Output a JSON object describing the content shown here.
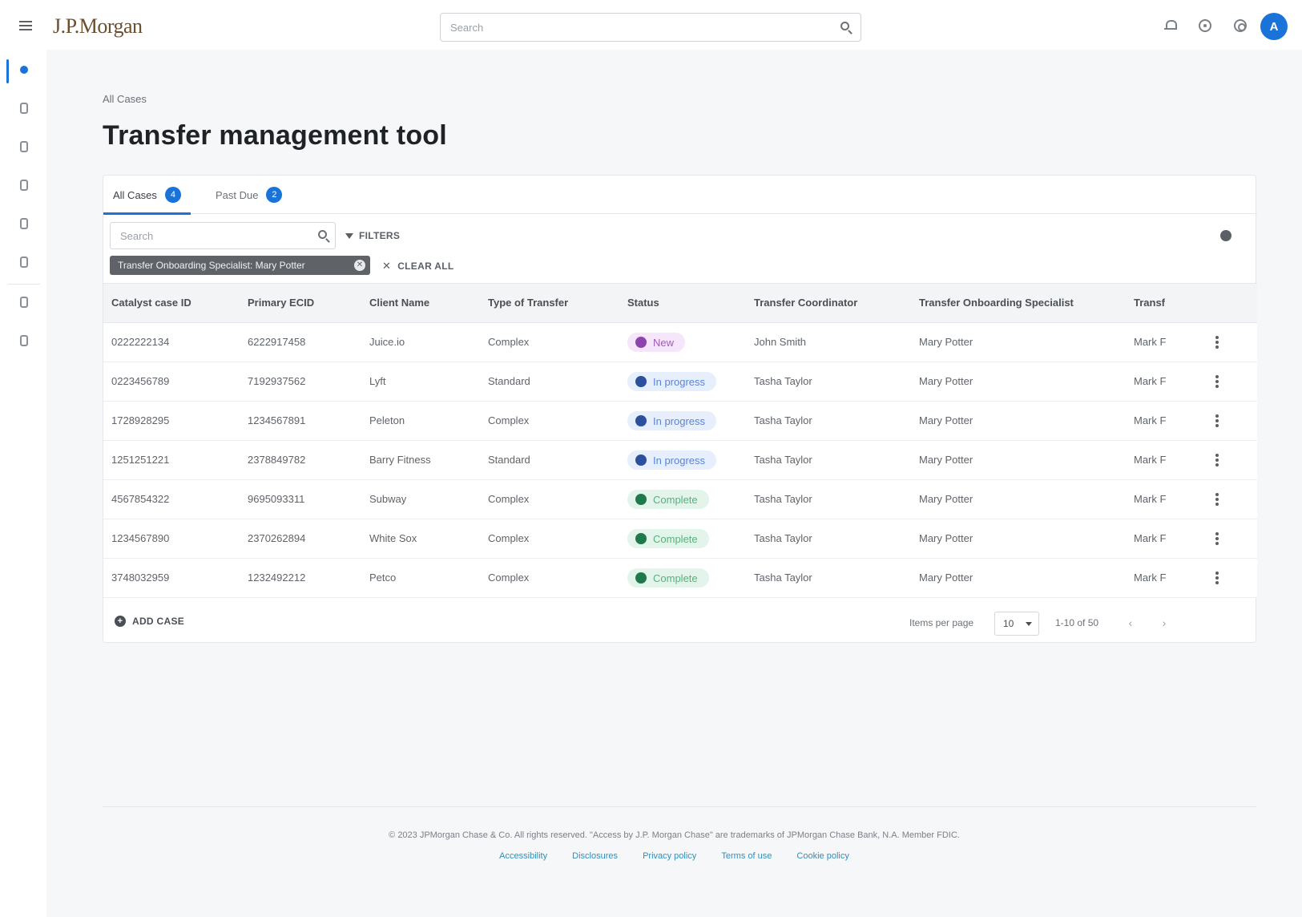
{
  "header": {
    "logo_text": "J.P.Morgan",
    "search_placeholder": "Search",
    "avatar_initial": "A"
  },
  "breadcrumb": "All Cases",
  "page_title": "Transfer management tool",
  "tabs": [
    {
      "label": "All Cases",
      "count": "4"
    },
    {
      "label": "Past Due",
      "count": "2"
    }
  ],
  "toolbar": {
    "search_placeholder": "Search",
    "filters_label": "FILTERS",
    "chip_label": "Transfer Onboarding Specialist: Mary Potter",
    "clear_all_label": "CLEAR ALL"
  },
  "table": {
    "columns": [
      "Catalyst case ID",
      "Primary ECID",
      "Client Name",
      "Type of Transfer",
      "Status",
      "Transfer Coordinator",
      "Transfer Onboarding Specialist",
      "Transf"
    ],
    "rows": [
      {
        "case_id": "0222222134",
        "ecid": "6222917458",
        "client": "Juice.io",
        "type": "Complex",
        "status": "New",
        "coordinator": "John Smith",
        "specialist": "Mary Potter",
        "extra": "Mark F"
      },
      {
        "case_id": "0223456789",
        "ecid": "7192937562",
        "client": "Lyft",
        "type": "Standard",
        "status": "In progress",
        "coordinator": "Tasha Taylor",
        "specialist": "Mary Potter",
        "extra": "Mark F"
      },
      {
        "case_id": "1728928295",
        "ecid": "1234567891",
        "client": "Peleton",
        "type": "Complex",
        "status": "In progress",
        "coordinator": "Tasha Taylor",
        "specialist": "Mary Potter",
        "extra": "Mark F"
      },
      {
        "case_id": "1251251221",
        "ecid": "2378849782",
        "client": "Barry Fitness",
        "type": "Standard",
        "status": "In progress",
        "coordinator": "Tasha Taylor",
        "specialist": "Mary Potter",
        "extra": "Mark F"
      },
      {
        "case_id": "4567854322",
        "ecid": "9695093311",
        "client": "Subway",
        "type": "Complex",
        "status": "Complete",
        "coordinator": "Tasha Taylor",
        "specialist": "Mary Potter",
        "extra": "Mark F"
      },
      {
        "case_id": "1234567890",
        "ecid": "2370262894",
        "client": "White Sox",
        "type": "Complex",
        "status": "Complete",
        "coordinator": "Tasha Taylor",
        "specialist": "Mary Potter",
        "extra": "Mark F"
      },
      {
        "case_id": "3748032959",
        "ecid": "1232492212",
        "client": "Petco",
        "type": "Complex",
        "status": "Complete",
        "coordinator": "Tasha Taylor",
        "specialist": "Mary Potter",
        "extra": "Mark F"
      }
    ]
  },
  "status_styles": {
    "New": {
      "bg": "#f6e6fb",
      "dot": "#8e44ad",
      "text": "#a35ac0"
    },
    "In progress": {
      "bg": "#e6effb",
      "dot": "#2c4f9e",
      "text": "#5b84d6"
    },
    "Complete": {
      "bg": "#e3f4ea",
      "dot": "#1e7a4b",
      "text": "#55b27e"
    }
  },
  "footer": {
    "add_case_label": "ADD CASE",
    "items_per_page_label": "Items per page",
    "items_per_page_value": "10",
    "range": "1-10 of 50",
    "copyright": "© 2023 JPMorgan Chase & Co. All rights reserved. \"Access by J.P. Morgan Chase\" are trademarks of JPMorgan Chase Bank, N.A. Member FDIC.",
    "links": [
      "Accessibility",
      "Disclosures",
      "Privacy policy",
      "Terms of use",
      "Cookie policy"
    ]
  }
}
